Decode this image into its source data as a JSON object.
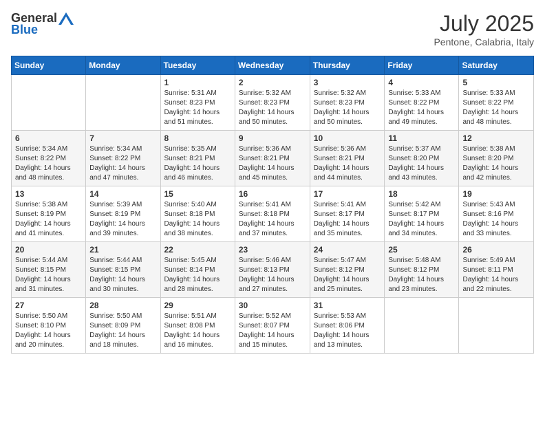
{
  "header": {
    "logo_general": "General",
    "logo_blue": "Blue",
    "month": "July 2025",
    "location": "Pentone, Calabria, Italy"
  },
  "weekdays": [
    "Sunday",
    "Monday",
    "Tuesday",
    "Wednesday",
    "Thursday",
    "Friday",
    "Saturday"
  ],
  "weeks": [
    [
      {
        "day": "",
        "sunrise": "",
        "sunset": "",
        "daylight": ""
      },
      {
        "day": "",
        "sunrise": "",
        "sunset": "",
        "daylight": ""
      },
      {
        "day": "1",
        "sunrise": "Sunrise: 5:31 AM",
        "sunset": "Sunset: 8:23 PM",
        "daylight": "Daylight: 14 hours and 51 minutes."
      },
      {
        "day": "2",
        "sunrise": "Sunrise: 5:32 AM",
        "sunset": "Sunset: 8:23 PM",
        "daylight": "Daylight: 14 hours and 50 minutes."
      },
      {
        "day": "3",
        "sunrise": "Sunrise: 5:32 AM",
        "sunset": "Sunset: 8:23 PM",
        "daylight": "Daylight: 14 hours and 50 minutes."
      },
      {
        "day": "4",
        "sunrise": "Sunrise: 5:33 AM",
        "sunset": "Sunset: 8:22 PM",
        "daylight": "Daylight: 14 hours and 49 minutes."
      },
      {
        "day": "5",
        "sunrise": "Sunrise: 5:33 AM",
        "sunset": "Sunset: 8:22 PM",
        "daylight": "Daylight: 14 hours and 48 minutes."
      }
    ],
    [
      {
        "day": "6",
        "sunrise": "Sunrise: 5:34 AM",
        "sunset": "Sunset: 8:22 PM",
        "daylight": "Daylight: 14 hours and 48 minutes."
      },
      {
        "day": "7",
        "sunrise": "Sunrise: 5:34 AM",
        "sunset": "Sunset: 8:22 PM",
        "daylight": "Daylight: 14 hours and 47 minutes."
      },
      {
        "day": "8",
        "sunrise": "Sunrise: 5:35 AM",
        "sunset": "Sunset: 8:21 PM",
        "daylight": "Daylight: 14 hours and 46 minutes."
      },
      {
        "day": "9",
        "sunrise": "Sunrise: 5:36 AM",
        "sunset": "Sunset: 8:21 PM",
        "daylight": "Daylight: 14 hours and 45 minutes."
      },
      {
        "day": "10",
        "sunrise": "Sunrise: 5:36 AM",
        "sunset": "Sunset: 8:21 PM",
        "daylight": "Daylight: 14 hours and 44 minutes."
      },
      {
        "day": "11",
        "sunrise": "Sunrise: 5:37 AM",
        "sunset": "Sunset: 8:20 PM",
        "daylight": "Daylight: 14 hours and 43 minutes."
      },
      {
        "day": "12",
        "sunrise": "Sunrise: 5:38 AM",
        "sunset": "Sunset: 8:20 PM",
        "daylight": "Daylight: 14 hours and 42 minutes."
      }
    ],
    [
      {
        "day": "13",
        "sunrise": "Sunrise: 5:38 AM",
        "sunset": "Sunset: 8:19 PM",
        "daylight": "Daylight: 14 hours and 41 minutes."
      },
      {
        "day": "14",
        "sunrise": "Sunrise: 5:39 AM",
        "sunset": "Sunset: 8:19 PM",
        "daylight": "Daylight: 14 hours and 39 minutes."
      },
      {
        "day": "15",
        "sunrise": "Sunrise: 5:40 AM",
        "sunset": "Sunset: 8:18 PM",
        "daylight": "Daylight: 14 hours and 38 minutes."
      },
      {
        "day": "16",
        "sunrise": "Sunrise: 5:41 AM",
        "sunset": "Sunset: 8:18 PM",
        "daylight": "Daylight: 14 hours and 37 minutes."
      },
      {
        "day": "17",
        "sunrise": "Sunrise: 5:41 AM",
        "sunset": "Sunset: 8:17 PM",
        "daylight": "Daylight: 14 hours and 35 minutes."
      },
      {
        "day": "18",
        "sunrise": "Sunrise: 5:42 AM",
        "sunset": "Sunset: 8:17 PM",
        "daylight": "Daylight: 14 hours and 34 minutes."
      },
      {
        "day": "19",
        "sunrise": "Sunrise: 5:43 AM",
        "sunset": "Sunset: 8:16 PM",
        "daylight": "Daylight: 14 hours and 33 minutes."
      }
    ],
    [
      {
        "day": "20",
        "sunrise": "Sunrise: 5:44 AM",
        "sunset": "Sunset: 8:15 PM",
        "daylight": "Daylight: 14 hours and 31 minutes."
      },
      {
        "day": "21",
        "sunrise": "Sunrise: 5:44 AM",
        "sunset": "Sunset: 8:15 PM",
        "daylight": "Daylight: 14 hours and 30 minutes."
      },
      {
        "day": "22",
        "sunrise": "Sunrise: 5:45 AM",
        "sunset": "Sunset: 8:14 PM",
        "daylight": "Daylight: 14 hours and 28 minutes."
      },
      {
        "day": "23",
        "sunrise": "Sunrise: 5:46 AM",
        "sunset": "Sunset: 8:13 PM",
        "daylight": "Daylight: 14 hours and 27 minutes."
      },
      {
        "day": "24",
        "sunrise": "Sunrise: 5:47 AM",
        "sunset": "Sunset: 8:12 PM",
        "daylight": "Daylight: 14 hours and 25 minutes."
      },
      {
        "day": "25",
        "sunrise": "Sunrise: 5:48 AM",
        "sunset": "Sunset: 8:12 PM",
        "daylight": "Daylight: 14 hours and 23 minutes."
      },
      {
        "day": "26",
        "sunrise": "Sunrise: 5:49 AM",
        "sunset": "Sunset: 8:11 PM",
        "daylight": "Daylight: 14 hours and 22 minutes."
      }
    ],
    [
      {
        "day": "27",
        "sunrise": "Sunrise: 5:50 AM",
        "sunset": "Sunset: 8:10 PM",
        "daylight": "Daylight: 14 hours and 20 minutes."
      },
      {
        "day": "28",
        "sunrise": "Sunrise: 5:50 AM",
        "sunset": "Sunset: 8:09 PM",
        "daylight": "Daylight: 14 hours and 18 minutes."
      },
      {
        "day": "29",
        "sunrise": "Sunrise: 5:51 AM",
        "sunset": "Sunset: 8:08 PM",
        "daylight": "Daylight: 14 hours and 16 minutes."
      },
      {
        "day": "30",
        "sunrise": "Sunrise: 5:52 AM",
        "sunset": "Sunset: 8:07 PM",
        "daylight": "Daylight: 14 hours and 15 minutes."
      },
      {
        "day": "31",
        "sunrise": "Sunrise: 5:53 AM",
        "sunset": "Sunset: 8:06 PM",
        "daylight": "Daylight: 14 hours and 13 minutes."
      },
      {
        "day": "",
        "sunrise": "",
        "sunset": "",
        "daylight": ""
      },
      {
        "day": "",
        "sunrise": "",
        "sunset": "",
        "daylight": ""
      }
    ]
  ]
}
